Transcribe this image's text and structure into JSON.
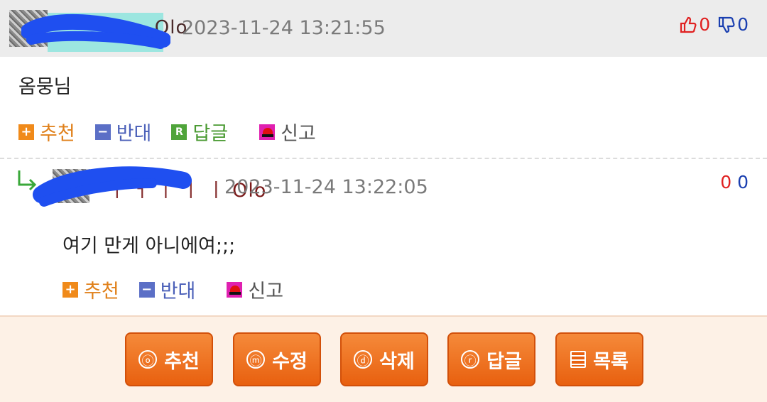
{
  "comment1": {
    "author_visible": "...Olo",
    "date": "2023-11-24 13:21:55",
    "up_count": "0",
    "down_count": "0",
    "body": "옴뭉님",
    "actions": {
      "recommend": "추천",
      "oppose": "반대",
      "reply": "답글",
      "report": "신고"
    }
  },
  "comment2": {
    "author_visible": "Olo",
    "date": "2023-11-24 13:22:05",
    "up_count": "0",
    "down_count": "0",
    "body": "여기 만게 아니에여;;;",
    "actions": {
      "recommend": "추천",
      "oppose": "반대",
      "report": "신고"
    }
  },
  "bottom_buttons": {
    "recommend": {
      "icon": "ⓞ",
      "label": "추천"
    },
    "edit": {
      "icon": "ⓜ",
      "label": "수정"
    },
    "delete": {
      "icon": "ⓓ",
      "label": "삭제"
    },
    "reply": {
      "icon": "ⓡ",
      "label": "답글"
    },
    "list": {
      "label": "목록"
    }
  },
  "colors": {
    "accent_orange": "#e8600f",
    "up": "#e02020",
    "down": "#1a3fb0"
  }
}
